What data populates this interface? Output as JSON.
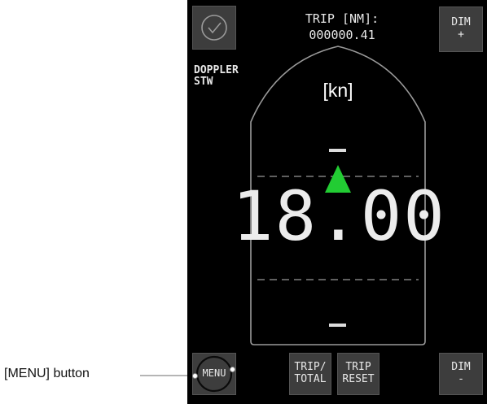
{
  "annotation": {
    "menu_label": "[MENU] button"
  },
  "header": {
    "trip_label": "TRIP [NM]:",
    "trip_value": "000000.41"
  },
  "buttons": {
    "dim_plus_top": "DIM",
    "dim_plus_bottom": "+",
    "dim_minus_top": "DIM",
    "dim_minus_bottom": "-",
    "trip_total_top": "TRIP/",
    "trip_total_bottom": "TOTAL",
    "trip_reset_top": "TRIP",
    "trip_reset_bottom": "RESET",
    "menu": "MENU"
  },
  "source": {
    "line1": "DOPPLER",
    "line2": "STW"
  },
  "display": {
    "unit": "[kn]",
    "speed": "18.00"
  },
  "colors": {
    "screen_bg": "#000000",
    "button_bg": "#3d3d3d",
    "arrow": "#22cc33",
    "hull": "#9a9a9a"
  },
  "icons": {
    "confirm": "check-circle-icon",
    "direction": "up-triangle-icon"
  }
}
